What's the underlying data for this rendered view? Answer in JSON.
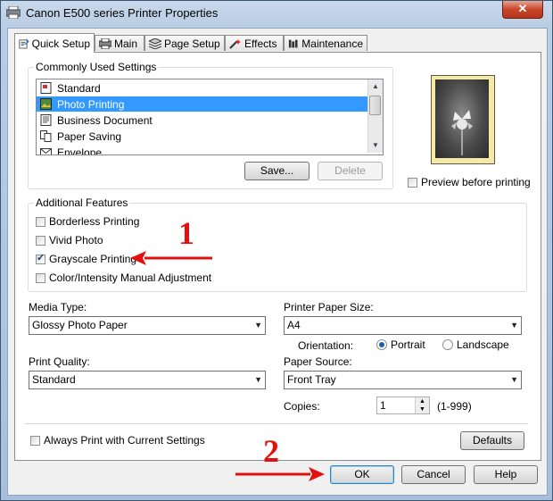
{
  "window": {
    "title": "Canon E500 series Printer Properties",
    "close_label": "✕"
  },
  "tabs": [
    {
      "label": "Quick Setup",
      "active": true,
      "icon": "quick-setup-icon"
    },
    {
      "label": "Main",
      "icon": "main-icon"
    },
    {
      "label": "Page Setup",
      "icon": "page-setup-icon"
    },
    {
      "label": "Effects",
      "icon": "effects-icon"
    },
    {
      "label": "Maintenance",
      "icon": "maintenance-icon"
    }
  ],
  "common_settings": {
    "group_label": "Commonly Used Settings",
    "items": [
      {
        "label": "Standard",
        "icon": "standard-icon"
      },
      {
        "label": "Photo Printing",
        "icon": "photo-icon",
        "selected": true
      },
      {
        "label": "Business Document",
        "icon": "document-icon"
      },
      {
        "label": "Paper Saving",
        "icon": "paper-saving-icon"
      },
      {
        "label": "Envelope",
        "icon": "envelope-icon"
      }
    ],
    "save_label": "Save...",
    "delete_label": "Delete"
  },
  "preview": {
    "checkbox_label": "Preview before printing",
    "checked": false
  },
  "additional": {
    "group_label": "Additional Features",
    "items": [
      {
        "label": "Borderless Printing",
        "checked": false
      },
      {
        "label": "Vivid Photo",
        "checked": false
      },
      {
        "label": "Grayscale Printing",
        "checked": true
      },
      {
        "label": "Color/Intensity Manual Adjustment",
        "checked": false
      }
    ]
  },
  "media_type": {
    "label": "Media Type:",
    "value": "Glossy Photo Paper"
  },
  "paper_size": {
    "label": "Printer Paper Size:",
    "value": "A4"
  },
  "orientation": {
    "label": "Orientation:",
    "portrait": "Portrait",
    "landscape": "Landscape",
    "selected": "Portrait"
  },
  "print_quality": {
    "label": "Print Quality:",
    "value": "Standard"
  },
  "paper_source": {
    "label": "Paper Source:",
    "value": "Front Tray"
  },
  "copies": {
    "label": "Copies:",
    "value": "1",
    "range": "(1-999)"
  },
  "always_print": {
    "label": "Always Print with Current Settings",
    "checked": false
  },
  "defaults_label": "Defaults",
  "footer": {
    "ok": "OK",
    "cancel": "Cancel",
    "help": "Help"
  },
  "annotations": {
    "step1": "1",
    "step2": "2",
    "color": "#e31010"
  }
}
